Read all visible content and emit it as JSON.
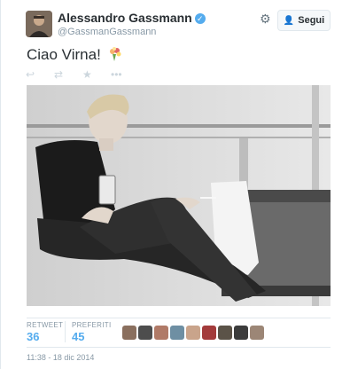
{
  "header": {
    "display_name": "Alessandro Gassmann",
    "handle": "@GassmanGassmann",
    "follow_label": "Segui"
  },
  "tweet": {
    "text": "Ciao Virna!"
  },
  "stats": {
    "retweet_label": "RETWEET",
    "retweet_count": "36",
    "favorites_label": "PREFERITI",
    "favorites_count": "45"
  },
  "timestamp": "11:38 - 18 dic 2014",
  "colors": {
    "accent": "#55acee",
    "text": "#292f33",
    "muted": "#8899a6",
    "border": "#e1e8ed"
  },
  "icons": {
    "verified": "verified-badge-icon",
    "settings": "gear-icon",
    "follow": "add-user-icon",
    "reply": "reply-icon",
    "retweet": "retweet-icon",
    "favorite": "star-icon",
    "more": "more-dots-icon"
  }
}
